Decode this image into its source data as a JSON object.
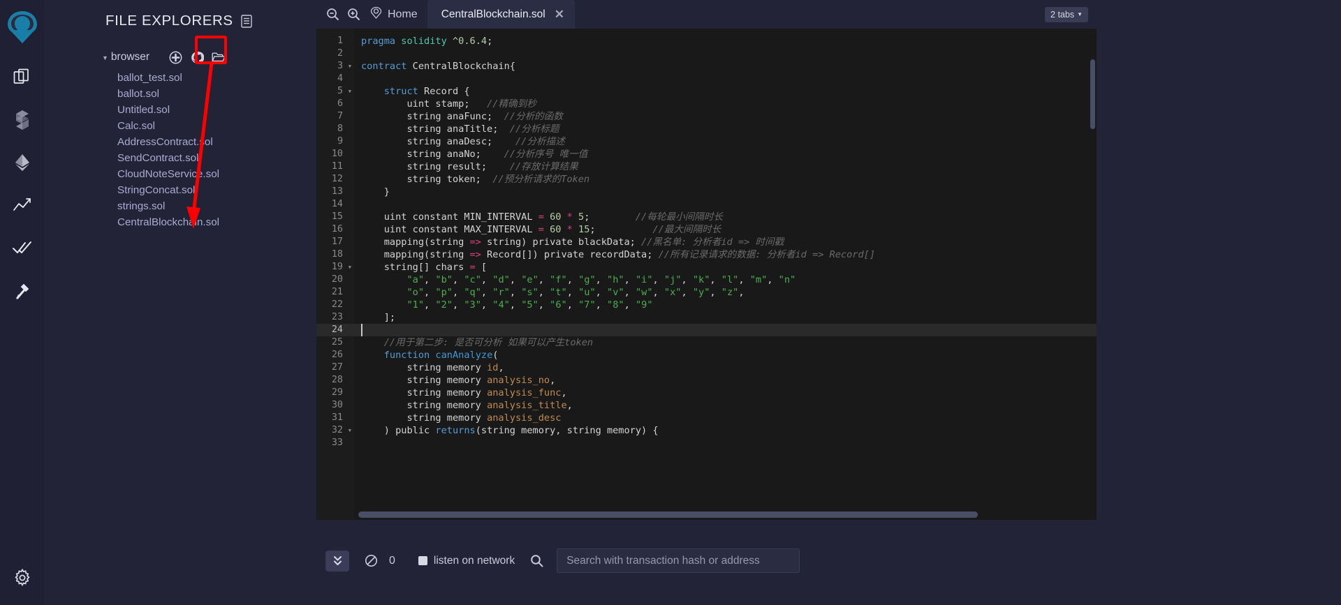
{
  "rail": {
    "logo": "remix-logo",
    "items": [
      {
        "name": "file-explorers-icon",
        "label": "File explorers"
      },
      {
        "name": "solidity-compiler-icon",
        "label": "Solidity compiler"
      },
      {
        "name": "deploy-run-icon",
        "label": "Deploy & run transactions"
      },
      {
        "name": "analysis-icon",
        "label": "Solidity static analysis"
      },
      {
        "name": "testing-icon",
        "label": "Solidity unit testing"
      },
      {
        "name": "debugger-icon",
        "label": "Debugger"
      }
    ],
    "settings": {
      "name": "settings-gear-icon",
      "label": "Settings"
    }
  },
  "explorer": {
    "title": "FILE EXPLORERS",
    "header_icon": "publish-to-gist-icon",
    "root": {
      "label": "browser",
      "expanded": true
    },
    "actions": [
      {
        "name": "create-new-file-icon",
        "label": "Create new file"
      },
      {
        "name": "publish-to-gist-icon",
        "label": "Publish to gist"
      },
      {
        "name": "open-folder-icon",
        "label": "Open local folder"
      }
    ],
    "files": [
      "ballot_test.sol",
      "ballot.sol",
      "Untitled.sol",
      "Calc.sol",
      "AddressContract.sol",
      "SendContract.sol",
      "CloudNoteService.sol",
      "StringConcat.sol",
      "strings.sol",
      "CentralBlockchain.sol"
    ],
    "annotation": {
      "color": "#fe0000",
      "target": "open-folder-icon"
    }
  },
  "tabbar": {
    "zoom_out_icon": "zoom-out-icon",
    "zoom_in_icon": "zoom-in-icon",
    "home_icon": "remix-home-icon",
    "home_label": "Home",
    "active_tab": "CentralBlockchain.sol",
    "close_icon": "close-icon",
    "tabs_count_label": "2 tabs"
  },
  "editor": {
    "active_line": 24,
    "first_line": 1,
    "last_line": 33,
    "lines": [
      {
        "n": 1,
        "fold": false,
        "tokens": [
          [
            "kw",
            "pragma"
          ],
          [
            "typ",
            " "
          ],
          [
            "kw2",
            "solidity"
          ],
          [
            "typ",
            " "
          ],
          [
            "ver",
            "^0.6.4"
          ],
          [
            "typ",
            ";"
          ]
        ]
      },
      {
        "n": 2,
        "fold": false,
        "tokens": [
          [
            "typ",
            ""
          ]
        ]
      },
      {
        "n": 3,
        "fold": true,
        "tokens": [
          [
            "kw",
            "contract"
          ],
          [
            "typ",
            " CentralBlockchain{"
          ]
        ]
      },
      {
        "n": 4,
        "fold": false,
        "tokens": [
          [
            "typ",
            ""
          ]
        ]
      },
      {
        "n": 5,
        "fold": true,
        "tokens": [
          [
            "typ",
            "    "
          ],
          [
            "kw",
            "struct"
          ],
          [
            "typ",
            " Record {"
          ]
        ]
      },
      {
        "n": 6,
        "fold": false,
        "tokens": [
          [
            "typ",
            "        uint stamp;   "
          ],
          [
            "com",
            "//精确到秒"
          ]
        ]
      },
      {
        "n": 7,
        "fold": false,
        "tokens": [
          [
            "typ",
            "        string anaFunc;  "
          ],
          [
            "com",
            "//分析的函数"
          ]
        ]
      },
      {
        "n": 8,
        "fold": false,
        "tokens": [
          [
            "typ",
            "        string anaTitle;  "
          ],
          [
            "com",
            "//分析标题"
          ]
        ]
      },
      {
        "n": 9,
        "fold": false,
        "tokens": [
          [
            "typ",
            "        string anaDesc;    "
          ],
          [
            "com",
            "//分析描述"
          ]
        ]
      },
      {
        "n": 10,
        "fold": false,
        "tokens": [
          [
            "typ",
            "        string anaNo;    "
          ],
          [
            "com",
            "//分析序号 唯一值"
          ]
        ]
      },
      {
        "n": 11,
        "fold": false,
        "tokens": [
          [
            "typ",
            "        string result;    "
          ],
          [
            "com",
            "//存放计算结果"
          ]
        ]
      },
      {
        "n": 12,
        "fold": false,
        "tokens": [
          [
            "typ",
            "        string token;  "
          ],
          [
            "com",
            "//预分析请求的Token"
          ]
        ]
      },
      {
        "n": 13,
        "fold": false,
        "tokens": [
          [
            "typ",
            "    }"
          ]
        ]
      },
      {
        "n": 14,
        "fold": false,
        "tokens": [
          [
            "typ",
            ""
          ]
        ]
      },
      {
        "n": 15,
        "fold": false,
        "tokens": [
          [
            "typ",
            "    uint constant MIN_INTERVAL "
          ],
          [
            "op",
            "="
          ],
          [
            "typ",
            " "
          ],
          [
            "num",
            "60"
          ],
          [
            "op",
            " * "
          ],
          [
            "num",
            "5"
          ],
          [
            "typ",
            ";        "
          ],
          [
            "com",
            "//每轮最小间隔时长"
          ]
        ]
      },
      {
        "n": 16,
        "fold": false,
        "tokens": [
          [
            "typ",
            "    uint constant MAX_INTERVAL "
          ],
          [
            "op",
            "="
          ],
          [
            "typ",
            " "
          ],
          [
            "num",
            "60"
          ],
          [
            "op",
            " * "
          ],
          [
            "num",
            "15"
          ],
          [
            "typ",
            ";          "
          ],
          [
            "com",
            "//最大间隔时长"
          ]
        ]
      },
      {
        "n": 17,
        "fold": false,
        "tokens": [
          [
            "typ",
            "    mapping(string "
          ],
          [
            "op",
            "=>"
          ],
          [
            "typ",
            " string) private blackData; "
          ],
          [
            "com",
            "//黑名单: 分析者id => 时间戳"
          ]
        ]
      },
      {
        "n": 18,
        "fold": false,
        "tokens": [
          [
            "typ",
            "    mapping(string "
          ],
          [
            "op",
            "=>"
          ],
          [
            "typ",
            " Record[]) private recordData; "
          ],
          [
            "com",
            "//所有记录请求的数据: 分析者id => Record[]"
          ]
        ]
      },
      {
        "n": 19,
        "fold": true,
        "tokens": [
          [
            "typ",
            "    string[] chars "
          ],
          [
            "op",
            "="
          ],
          [
            "typ",
            " ["
          ]
        ]
      },
      {
        "n": 20,
        "fold": false,
        "tokens": [
          [
            "typ",
            "        "
          ],
          [
            "str",
            "\"a\""
          ],
          [
            "typ",
            ", "
          ],
          [
            "str",
            "\"b\""
          ],
          [
            "typ",
            ", "
          ],
          [
            "str",
            "\"c\""
          ],
          [
            "typ",
            ", "
          ],
          [
            "str",
            "\"d\""
          ],
          [
            "typ",
            ", "
          ],
          [
            "str",
            "\"e\""
          ],
          [
            "typ",
            ", "
          ],
          [
            "str",
            "\"f\""
          ],
          [
            "typ",
            ", "
          ],
          [
            "str",
            "\"g\""
          ],
          [
            "typ",
            ", "
          ],
          [
            "str",
            "\"h\""
          ],
          [
            "typ",
            ", "
          ],
          [
            "str",
            "\"i\""
          ],
          [
            "typ",
            ", "
          ],
          [
            "str",
            "\"j\""
          ],
          [
            "typ",
            ", "
          ],
          [
            "str",
            "\"k\""
          ],
          [
            "typ",
            ", "
          ],
          [
            "str",
            "\"l\""
          ],
          [
            "typ",
            ", "
          ],
          [
            "str",
            "\"m\""
          ],
          [
            "typ",
            ", "
          ],
          [
            "str",
            "\"n\""
          ]
        ]
      },
      {
        "n": 21,
        "fold": false,
        "tokens": [
          [
            "typ",
            "        "
          ],
          [
            "str",
            "\"o\""
          ],
          [
            "typ",
            ", "
          ],
          [
            "str",
            "\"p\""
          ],
          [
            "typ",
            ", "
          ],
          [
            "str",
            "\"q\""
          ],
          [
            "typ",
            ", "
          ],
          [
            "str",
            "\"r\""
          ],
          [
            "typ",
            ", "
          ],
          [
            "str",
            "\"s\""
          ],
          [
            "typ",
            ", "
          ],
          [
            "str",
            "\"t\""
          ],
          [
            "typ",
            ", "
          ],
          [
            "str",
            "\"u\""
          ],
          [
            "typ",
            ", "
          ],
          [
            "str",
            "\"v\""
          ],
          [
            "typ",
            ", "
          ],
          [
            "str",
            "\"w\""
          ],
          [
            "typ",
            ", "
          ],
          [
            "str",
            "\"x\""
          ],
          [
            "typ",
            ", "
          ],
          [
            "str",
            "\"y\""
          ],
          [
            "typ",
            ", "
          ],
          [
            "str",
            "\"z\""
          ],
          [
            "typ",
            ","
          ]
        ]
      },
      {
        "n": 22,
        "fold": false,
        "tokens": [
          [
            "typ",
            "        "
          ],
          [
            "str",
            "\"1\""
          ],
          [
            "typ",
            ", "
          ],
          [
            "str",
            "\"2\""
          ],
          [
            "typ",
            ", "
          ],
          [
            "str",
            "\"3\""
          ],
          [
            "typ",
            ", "
          ],
          [
            "str",
            "\"4\""
          ],
          [
            "typ",
            ", "
          ],
          [
            "str",
            "\"5\""
          ],
          [
            "typ",
            ", "
          ],
          [
            "str",
            "\"6\""
          ],
          [
            "typ",
            ", "
          ],
          [
            "str",
            "\"7\""
          ],
          [
            "typ",
            ", "
          ],
          [
            "str",
            "\"8\""
          ],
          [
            "typ",
            ", "
          ],
          [
            "str",
            "\"9\""
          ]
        ]
      },
      {
        "n": 23,
        "fold": false,
        "tokens": [
          [
            "typ",
            "    ];"
          ]
        ]
      },
      {
        "n": 24,
        "fold": false,
        "tokens": [
          [
            "typ",
            ""
          ]
        ]
      },
      {
        "n": 25,
        "fold": false,
        "tokens": [
          [
            "typ",
            "    "
          ],
          [
            "com",
            "//用于第二步: 是否可分析 如果可以产生token"
          ]
        ]
      },
      {
        "n": 26,
        "fold": false,
        "tokens": [
          [
            "typ",
            "    "
          ],
          [
            "kw",
            "function"
          ],
          [
            "typ",
            " "
          ],
          [
            "fn",
            "canAnalyze"
          ],
          [
            "typ",
            "("
          ]
        ]
      },
      {
        "n": 27,
        "fold": false,
        "tokens": [
          [
            "typ",
            "        string memory "
          ],
          [
            "prm",
            "id"
          ],
          [
            "typ",
            ","
          ]
        ]
      },
      {
        "n": 28,
        "fold": false,
        "tokens": [
          [
            "typ",
            "        string memory "
          ],
          [
            "prm",
            "analysis_no"
          ],
          [
            "typ",
            ","
          ]
        ]
      },
      {
        "n": 29,
        "fold": false,
        "tokens": [
          [
            "typ",
            "        string memory "
          ],
          [
            "prm",
            "analysis_func"
          ],
          [
            "typ",
            ","
          ]
        ]
      },
      {
        "n": 30,
        "fold": false,
        "tokens": [
          [
            "typ",
            "        string memory "
          ],
          [
            "prm",
            "analysis_title"
          ],
          [
            "typ",
            ","
          ]
        ]
      },
      {
        "n": 31,
        "fold": false,
        "tokens": [
          [
            "typ",
            "        string memory "
          ],
          [
            "prm",
            "analysis_desc"
          ]
        ]
      },
      {
        "n": 32,
        "fold": true,
        "tokens": [
          [
            "typ",
            "    ) public "
          ],
          [
            "kw",
            "returns"
          ],
          [
            "typ",
            "(string memory, string memory) {"
          ]
        ]
      },
      {
        "n": 33,
        "fold": false,
        "tokens": [
          [
            "typ",
            ""
          ]
        ]
      }
    ]
  },
  "terminal": {
    "toggle_icon": "chevrons-down-icon",
    "clear_icon": "no-entry-icon",
    "pending_count": "0",
    "listen_label": "listen on network",
    "listen_checked": true,
    "search_icon": "search-icon",
    "search_placeholder": "Search with transaction hash or address"
  },
  "colors": {
    "accent": "#1a7fa8",
    "annotation": "#fe0000",
    "panel_bg": "#222336",
    "editor_bg": "#191919"
  }
}
